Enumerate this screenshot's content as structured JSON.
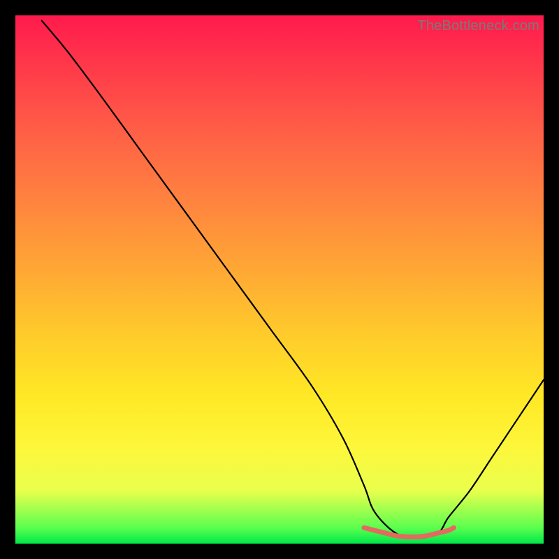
{
  "watermark": "TheBottleneck.com",
  "chart_data": {
    "type": "line",
    "title": "",
    "xlabel": "",
    "ylabel": "",
    "xlim": [
      0,
      100
    ],
    "ylim": [
      0,
      100
    ],
    "grid": false,
    "legend": false,
    "annotations": [
      {
        "text": "TheBottleneck.com",
        "pos": "top-right"
      }
    ],
    "description": "Bottleneck percentage curve (high = large mismatch, low = balanced) across a horizontal range; minimum plateau near x≈68–82, rising toward both ends. Background is a vertical red→yellow→green gradient (top=worst, bottom=best).",
    "series": [
      {
        "name": "bottleneck-curve-black",
        "color": "#000000",
        "x": [
          5,
          10,
          16,
          24,
          32,
          40,
          48,
          56,
          62,
          66,
          68,
          72,
          76,
          80,
          82,
          86,
          90,
          94,
          100
        ],
        "values": [
          99,
          93,
          85,
          74,
          63,
          52,
          41,
          30,
          20,
          11,
          6,
          2,
          1,
          2,
          5,
          10,
          16,
          22,
          31
        ]
      },
      {
        "name": "optimal-range-marker-salmon",
        "color": "#e36a60",
        "x": [
          66,
          68,
          70,
          72,
          74,
          76,
          78,
          80,
          82,
          83
        ],
        "values": [
          3,
          2.5,
          2,
          1.5,
          1.3,
          1.3,
          1.5,
          2,
          2.5,
          3
        ]
      }
    ],
    "gradient_scale": {
      "orientation": "vertical",
      "top_color": "#ff1a4d",
      "mid_color": "#ffd531",
      "bottom_color": "#00e84a",
      "meaning": "top=high bottleneck, bottom=low bottleneck"
    }
  }
}
